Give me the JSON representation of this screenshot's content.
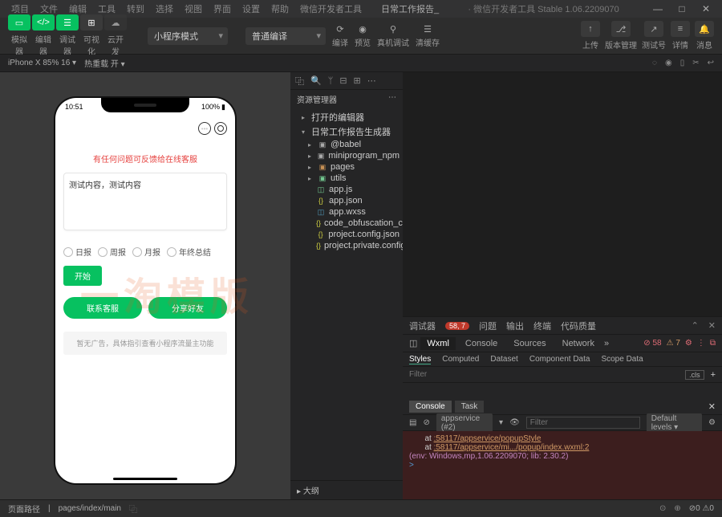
{
  "title": {
    "menus": [
      "项目",
      "文件",
      "编辑",
      "工具",
      "转到",
      "选择",
      "视图",
      "界面",
      "设置",
      "帮助",
      "微信开发者工具"
    ],
    "doc": "日常工作报告_",
    "app": "· 微信开发者工具 Stable 1.06.2209070"
  },
  "toolbar": {
    "group1_labels": [
      "模拟器",
      "编辑器",
      "调试器",
      "可视化",
      "云开发"
    ],
    "select1": "小程序模式",
    "select2": "普通编译",
    "actions": [
      "编译",
      "预览",
      "真机调试",
      "清缓存"
    ],
    "right_labels": [
      "上传",
      "版本管理",
      "测试号",
      "详情",
      "消息"
    ]
  },
  "devicebar": {
    "device": "iPhone X 85% 16 ▾",
    "hot_reload": "热重载 开 ▾"
  },
  "phone": {
    "time": "10:51",
    "battery": "100%",
    "notice": "有任何问题可反馈给在线客服",
    "textarea": "测试内容，测试内容",
    "radios": [
      "日报",
      "周报",
      "月报",
      "年终总结"
    ],
    "start": "开始",
    "btn1": "联系客服",
    "btn2": "分享好友",
    "ad": "暂无广告，具体指引查看小程序流量主功能"
  },
  "watermark": "一淘模版",
  "explorer": {
    "title": "资源管理器",
    "open_editors": "打开的编辑器",
    "project": "日常工作报告生成器",
    "folders": [
      "@babel",
      "miniprogram_npm",
      "pages",
      "utils"
    ],
    "files": [
      {
        "name": "app.js",
        "icon": "js"
      },
      {
        "name": "app.json",
        "icon": "json"
      },
      {
        "name": "app.wxss",
        "icon": "wxss"
      },
      {
        "name": "code_obfuscation_conf...",
        "icon": "json"
      },
      {
        "name": "project.config.json",
        "icon": "json"
      },
      {
        "name": "project.private.config.js...",
        "icon": "json"
      }
    ],
    "outline": "大纲"
  },
  "devtools": {
    "tabs1": [
      "调试器",
      "问题",
      "输出",
      "终端",
      "代码质量"
    ],
    "badge1": "58, 7",
    "tabs2": [
      "Wxml",
      "Console",
      "Sources",
      "Network"
    ],
    "errors": "58",
    "warns": "7",
    "styles_tabs": [
      "Styles",
      "Computed",
      "Dataset",
      "Component Data",
      "Scope Data"
    ],
    "filter_placeholder": "Filter",
    "cls": ".cls",
    "console_tabs": [
      "Console",
      "Task"
    ],
    "context": "appservice (#2)",
    "filter2_placeholder": "Filter",
    "levels": "Default levels ▾",
    "log1_at": "at ",
    "log1_link": ":58117/appservice/popupStyle",
    "log2_at": "at ",
    "log2_link": ":58117/appservice/mi.../popup/index.wxml:2",
    "log3": "(env: Windows,mp,1.06.2209070; lib: 2.30.2)",
    "prompt": ">"
  },
  "footer": {
    "path_label": "页面路径",
    "path": "pages/index/main",
    "counts": "⊘0 ⚠0"
  }
}
